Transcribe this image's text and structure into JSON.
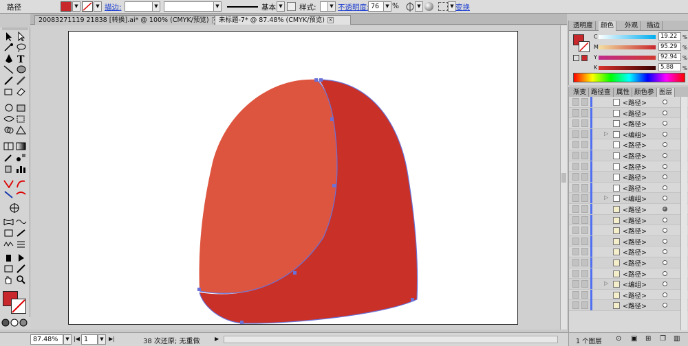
{
  "control_bar": {
    "object_type": "路径",
    "fill_color": "#c8272b",
    "stroke_label": "描边:",
    "stroke_weight": "",
    "brush_label": "基本",
    "style_label": "样式:",
    "opacity_label": "不透明度:",
    "opacity_value": "76",
    "opacity_unit": "%",
    "transform_label": "变换"
  },
  "doc_tabs": [
    {
      "label": "20083271119 21838 [转换].ai* @ 100% (CMYK/预览)",
      "active": false
    },
    {
      "label": "未标题-7* @ 87.48% (CMYK/预览)",
      "active": true
    }
  ],
  "canvas": {
    "shape_light_color": "#de553f",
    "shape_dark_color": "#c83028",
    "path_color": "#6a72d8"
  },
  "status_bar": {
    "zoom": "87.48%",
    "page": "1",
    "message": "38 次还原; 无重做"
  },
  "color_panel": {
    "tabs": [
      "透明度",
      "颜色",
      "外观",
      "描边"
    ],
    "active_tab": "颜色",
    "channels": [
      {
        "label": "C",
        "value": "19.22",
        "unit": "%"
      },
      {
        "label": "M",
        "value": "95.29",
        "unit": "%"
      },
      {
        "label": "Y",
        "value": "92.94",
        "unit": "%"
      },
      {
        "label": "K",
        "value": "5.88",
        "unit": "%"
      }
    ],
    "fill_swatch": "#c8272b"
  },
  "layers_panel": {
    "tabs": [
      "渐变",
      "路径查",
      "属性",
      "颜色参",
      "图层"
    ],
    "active_tab": "图层",
    "rows": [
      {
        "name": "<路径>",
        "group": false,
        "target": "empty"
      },
      {
        "name": "<路径>",
        "group": false,
        "target": "empty"
      },
      {
        "name": "<路径>",
        "group": false,
        "target": "empty"
      },
      {
        "name": "<编组>",
        "group": true,
        "target": "empty"
      },
      {
        "name": "<路径>",
        "group": false,
        "target": "empty"
      },
      {
        "name": "<路径>",
        "group": false,
        "target": "empty"
      },
      {
        "name": "<路径>",
        "group": false,
        "target": "empty"
      },
      {
        "name": "<路径>",
        "group": false,
        "target": "empty"
      },
      {
        "name": "<路径>",
        "group": false,
        "target": "empty"
      },
      {
        "name": "<编组>",
        "group": true,
        "target": "empty"
      },
      {
        "name": "<路径>",
        "group": false,
        "target": "filled"
      },
      {
        "name": "<路径>",
        "group": false,
        "target": "empty"
      },
      {
        "name": "<路径>",
        "group": false,
        "target": "empty"
      },
      {
        "name": "<路径>",
        "group": false,
        "target": "empty"
      },
      {
        "name": "<路径>",
        "group": false,
        "target": "empty"
      },
      {
        "name": "<路径>",
        "group": false,
        "target": "empty"
      },
      {
        "name": "<路径>",
        "group": false,
        "target": "empty"
      },
      {
        "name": "<编组>",
        "group": true,
        "target": "empty"
      },
      {
        "name": "<路径>",
        "group": false,
        "target": "empty"
      },
      {
        "name": "<路径>",
        "group": false,
        "target": "empty"
      }
    ],
    "footer": "1 个图层"
  }
}
